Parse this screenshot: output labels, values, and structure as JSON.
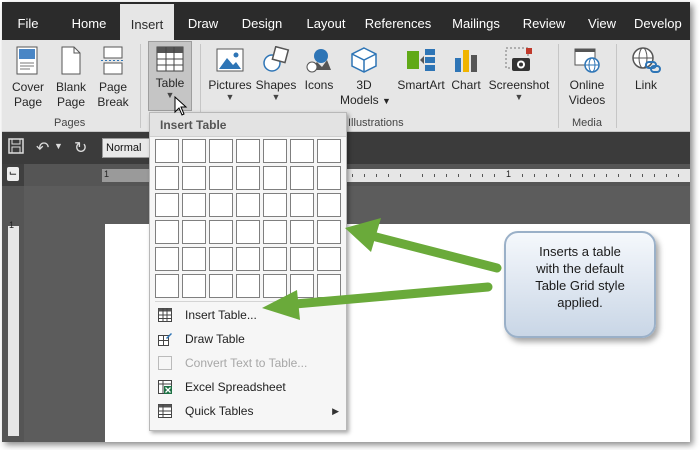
{
  "ribbon_tabs": [
    "File",
    "Home",
    "Insert",
    "Draw",
    "Design",
    "Layout",
    "References",
    "Mailings",
    "Review",
    "View",
    "Develop"
  ],
  "active_tab": "Insert",
  "ribbon": {
    "cover_page": {
      "line1": "Cover",
      "line2": "Page"
    },
    "blank_page": {
      "line1": "Blank",
      "line2": "Page"
    },
    "page_break": {
      "line1": "Page",
      "line2": "Break"
    },
    "pages_group": "Pages",
    "table": {
      "line1": "Table"
    },
    "pictures": "Pictures",
    "shapes": "Shapes",
    "icons": "Icons",
    "models_3d": {
      "line1": "3D",
      "line2": "Models"
    },
    "smartart": "SmartArt",
    "chart": "Chart",
    "screenshot": "Screenshot",
    "illustrations_group": "Illustrations",
    "online_videos": {
      "line1": "Online",
      "line2": "Videos"
    },
    "media_group": "Media",
    "link": "Link"
  },
  "quick_access": {
    "style_value": "Normal"
  },
  "ruler": {
    "left_num": "1",
    "mid_num": "1"
  },
  "vruler": {
    "num": "1"
  },
  "dropdown": {
    "title": "Insert Table",
    "grid_cols": 7,
    "grid_rows": 6,
    "items": [
      {
        "label": "Insert Table...",
        "icon": "table-icon",
        "enabled": true
      },
      {
        "label": "Draw Table",
        "icon": "draw-table-icon",
        "enabled": true
      },
      {
        "label": "Convert Text to Table...",
        "icon": "convert-icon",
        "enabled": false
      },
      {
        "label": "Excel Spreadsheet",
        "icon": "excel-icon",
        "enabled": true
      },
      {
        "label": "Quick Tables",
        "icon": "quick-tables-icon",
        "enabled": true,
        "submenu": true
      }
    ]
  },
  "callout": {
    "lines": [
      "Inserts a table",
      "with the default",
      "Table Grid style",
      "applied."
    ]
  },
  "colors": {
    "tab_bar": "#2b2b2b",
    "ribbon_bg": "#e6e6e6",
    "workspace": "#5c5c5c",
    "arrow_green": "#6aaa3a",
    "callout_border": "#9ab0c8"
  }
}
